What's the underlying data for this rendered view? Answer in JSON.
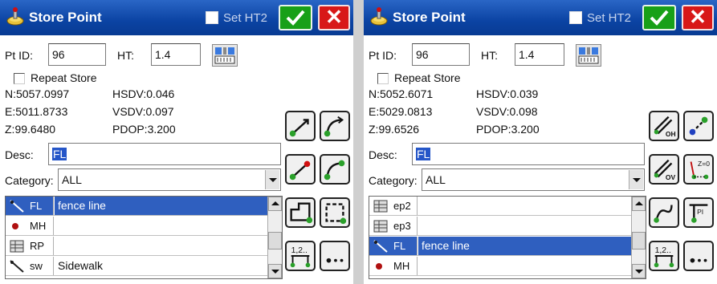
{
  "panels": [
    {
      "title": "Store Point",
      "set_ht_label": "Set HT2",
      "pt_id_label": "Pt ID:",
      "pt_id_value": "96",
      "ht_label": "HT:",
      "ht_value": "1.4",
      "repeat_store_label": "Repeat Store",
      "northing": "N:5057.0997",
      "easting": "E:5011.8733",
      "elevation": "Z:99.6480",
      "hsdv": "HSDV:0.046",
      "vsdv": "VSDV:0.097",
      "pdop": "PDOP:3.200",
      "desc_label": "Desc:",
      "desc_value": "FL",
      "category_label": "Category:",
      "category_value": "ALL",
      "rows": [
        {
          "code": "FL",
          "desc": "fence line",
          "selected": true,
          "icon": "line-code-icon"
        },
        {
          "code": "MH",
          "desc": "",
          "selected": false,
          "icon": "point-code-icon"
        },
        {
          "code": "RP",
          "desc": "",
          "selected": false,
          "icon": "table-code-icon"
        },
        {
          "code": "sw",
          "desc": "Sidewalk",
          "selected": false,
          "icon": "line-code-icon"
        }
      ],
      "tools": [
        "line-start-icon",
        "arc-start-icon",
        "line-end-icon",
        "arc-end-icon",
        "close-rect-icon",
        "close-square-icon",
        "numbered-points-icon",
        "more-options-icon"
      ]
    },
    {
      "title": "Store Point",
      "set_ht_label": "Set HT2",
      "pt_id_label": "Pt ID:",
      "pt_id_value": "96",
      "ht_label": "HT:",
      "ht_value": "1.4",
      "repeat_store_label": "Repeat Store",
      "northing": "N:5052.6071",
      "easting": "E:5029.0813",
      "elevation": "Z:99.6526",
      "hsdv": "HSDV:0.039",
      "vsdv": "VSDV:0.098",
      "pdop": "PDOP:3.200",
      "desc_label": "Desc:",
      "desc_value": "FL",
      "category_label": "Category:",
      "category_value": "ALL",
      "rows": [
        {
          "code": "ep2",
          "desc": "",
          "selected": false,
          "icon": "table-code-icon"
        },
        {
          "code": "ep3",
          "desc": "",
          "selected": false,
          "icon": "table-code-icon"
        },
        {
          "code": "FL",
          "desc": "fence line",
          "selected": true,
          "icon": "line-code-icon"
        },
        {
          "code": "MH",
          "desc": "",
          "selected": false,
          "icon": "point-code-icon"
        }
      ],
      "tools": [
        "offset-horizontal-icon",
        "point-link-icon",
        "offset-vertical-icon",
        "zero-elevation-icon",
        "curve-icon",
        "pi-point-icon",
        "numbered-points-icon",
        "more-options-icon"
      ]
    }
  ],
  "colors": {
    "titlebar": "#0b43a3",
    "ok_green": "#18a018",
    "cancel_red": "#d81818",
    "selection_blue": "#2f5fbf"
  }
}
